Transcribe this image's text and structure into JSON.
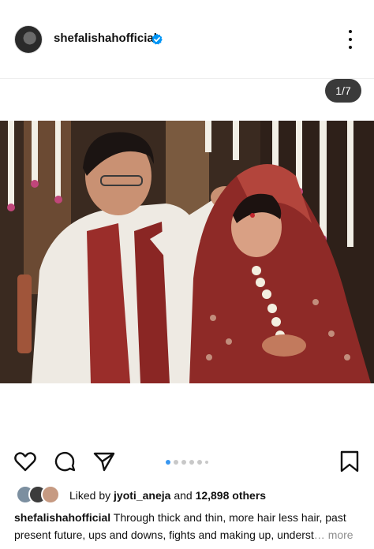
{
  "post": {
    "username": "shefalishahofficial",
    "verified": true,
    "counter": "1/7",
    "carousel": {
      "current": 1,
      "total": 7
    }
  },
  "icons": {
    "avatar": "profile-avatar",
    "verified": "verified-badge-icon",
    "more": "more-vertical-icon",
    "like": "heart-icon",
    "comment": "comment-bubble-icon",
    "share": "paper-plane-icon",
    "save": "bookmark-icon"
  },
  "likes": {
    "prefix": "Liked by",
    "user": "jyoti_aneja",
    "middle": "and",
    "count": "12,898 others"
  },
  "caption": {
    "username": "shefalishahofficial",
    "text": "Through thick and thin, more hair less hair, past present future, ups and downs, fights and making up, underst",
    "more": "more"
  },
  "colors": {
    "accent": "#3897f0",
    "verified": "#0095f6",
    "counter_bg": "#3a3a3a",
    "muted": "#8e8e8e"
  }
}
